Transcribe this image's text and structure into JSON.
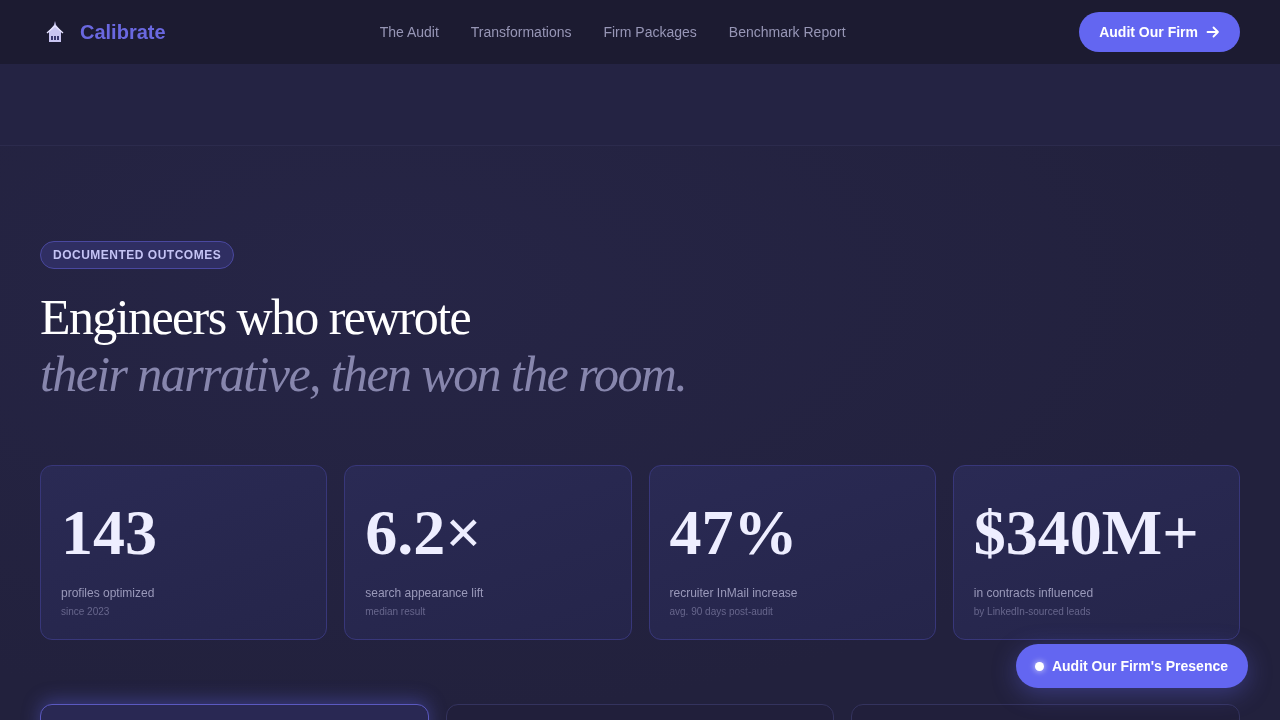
{
  "nav": {
    "brand": "Calibrate",
    "links": [
      "The Audit",
      "Transformations",
      "Firm Packages",
      "Benchmark Report"
    ],
    "cta": "Audit Our Firm"
  },
  "hero": {
    "badge": "DOCUMENTED OUTCOMES",
    "title": "Engineers who rewrote",
    "title_italic": "their narrative, then won the room."
  },
  "stats": [
    {
      "value": "143",
      "label": "profiles optimized",
      "note": "since 2023"
    },
    {
      "value": "6.2×",
      "label": "search appearance lift",
      "note": "median result"
    },
    {
      "value": "47%",
      "label": "recruiter InMail increase",
      "note": "avg. 90 days post-audit"
    },
    {
      "value": "$340M+",
      "label": "in contracts influenced",
      "note": "by LinkedIn-sourced leads"
    }
  ],
  "cards": [
    {
      "selected": true
    },
    {
      "selected": false
    },
    {
      "selected": false
    }
  ],
  "floating_button": {
    "label": "Audit Our Firm's Presence"
  }
}
